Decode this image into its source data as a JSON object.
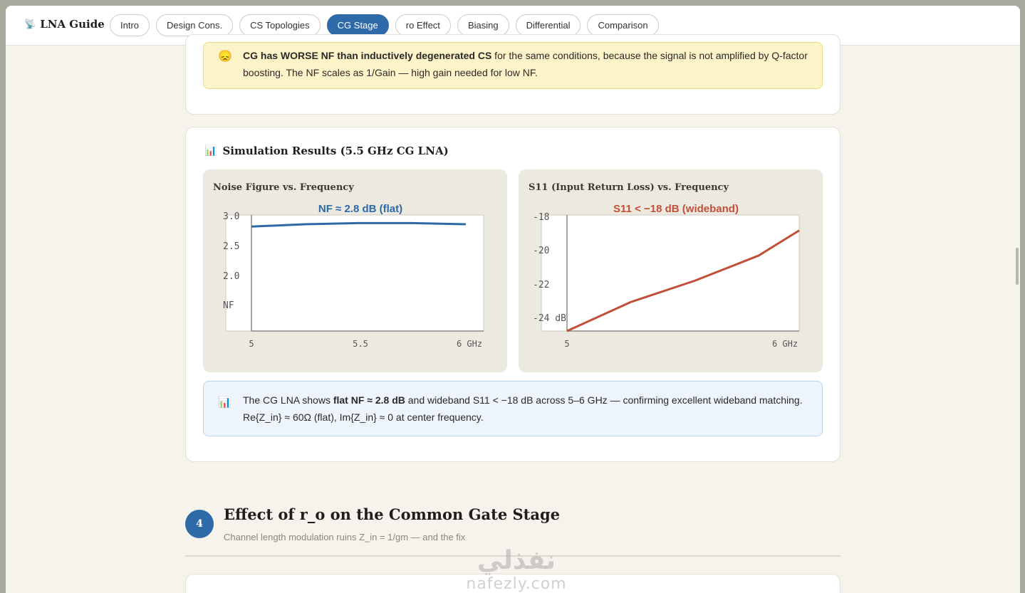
{
  "nav": {
    "brand": "LNA Guide",
    "tabs": [
      "Intro",
      "Design Cons.",
      "CS Topologies",
      "CG Stage",
      "ro Effect",
      "Biasing",
      "Differential",
      "Comparison"
    ],
    "active_tab": "CG Stage"
  },
  "warning": {
    "emoji": "😞",
    "bold": "CG has WORSE NF than inductively degenerated CS",
    "text": " for the same conditions, because the signal is not amplified by Q-factor boosting. The NF scales as 1/Gain — high gain needed for low NF."
  },
  "simulation": {
    "icon": "📊",
    "title": "Simulation Results (5.5 GHz CG LNA)"
  },
  "chart_data": [
    {
      "type": "line",
      "title": "Noise Figure vs. Frequency",
      "annotation": "NF ≈ 2.8 dB (flat)",
      "ylabel": "NF",
      "x_tick_labels": [
        "5",
        "5.5",
        "6 GHz"
      ],
      "y_tick_labels": [
        "3.0",
        "2.5",
        "2.0"
      ],
      "xlim": [
        4.9,
        6.2
      ],
      "ylim": [
        1.0,
        3.0
      ],
      "x": [
        4.9,
        5.2,
        5.5,
        5.8,
        6.1
      ],
      "values": [
        2.8,
        2.84,
        2.86,
        2.86,
        2.84
      ],
      "color": "#2e6aa8"
    },
    {
      "type": "line",
      "title": "S11 (Input Return Loss) vs. Frequency",
      "annotation": "S11 < −18 dB (wideband)",
      "x_tick_labels": [
        "5",
        "6 GHz"
      ],
      "y_tick_labels": [
        "-18",
        "-20",
        "-22",
        "-24 dB"
      ],
      "xlim": [
        5.0,
        6.2
      ],
      "ylim": [
        -24.0,
        -18.0
      ],
      "x": [
        5.0,
        5.33,
        5.66,
        5.99,
        6.2
      ],
      "values": [
        -24.0,
        -22.5,
        -21.4,
        -20.1,
        -18.8
      ],
      "color": "#c0503a"
    }
  ],
  "info": {
    "emoji": "📊",
    "pre": "The CG LNA shows ",
    "bold": "flat NF ≈ 2.8 dB",
    "post": " and wideband S11 < −18 dB across 5–6 GHz — confirming excellent wideband matching. Re{Z_in} ≈ 60Ω (flat), Im{Z_in} ≈ 0 at center frequency."
  },
  "section": {
    "number": "4",
    "title": "Effect of r_o on the Common Gate Stage",
    "subtitle": "Channel length modulation ruins Z_in = 1/gm — and the fix"
  },
  "watermark": {
    "arabic": "نفذلي",
    "latin": "nafezly.com"
  }
}
